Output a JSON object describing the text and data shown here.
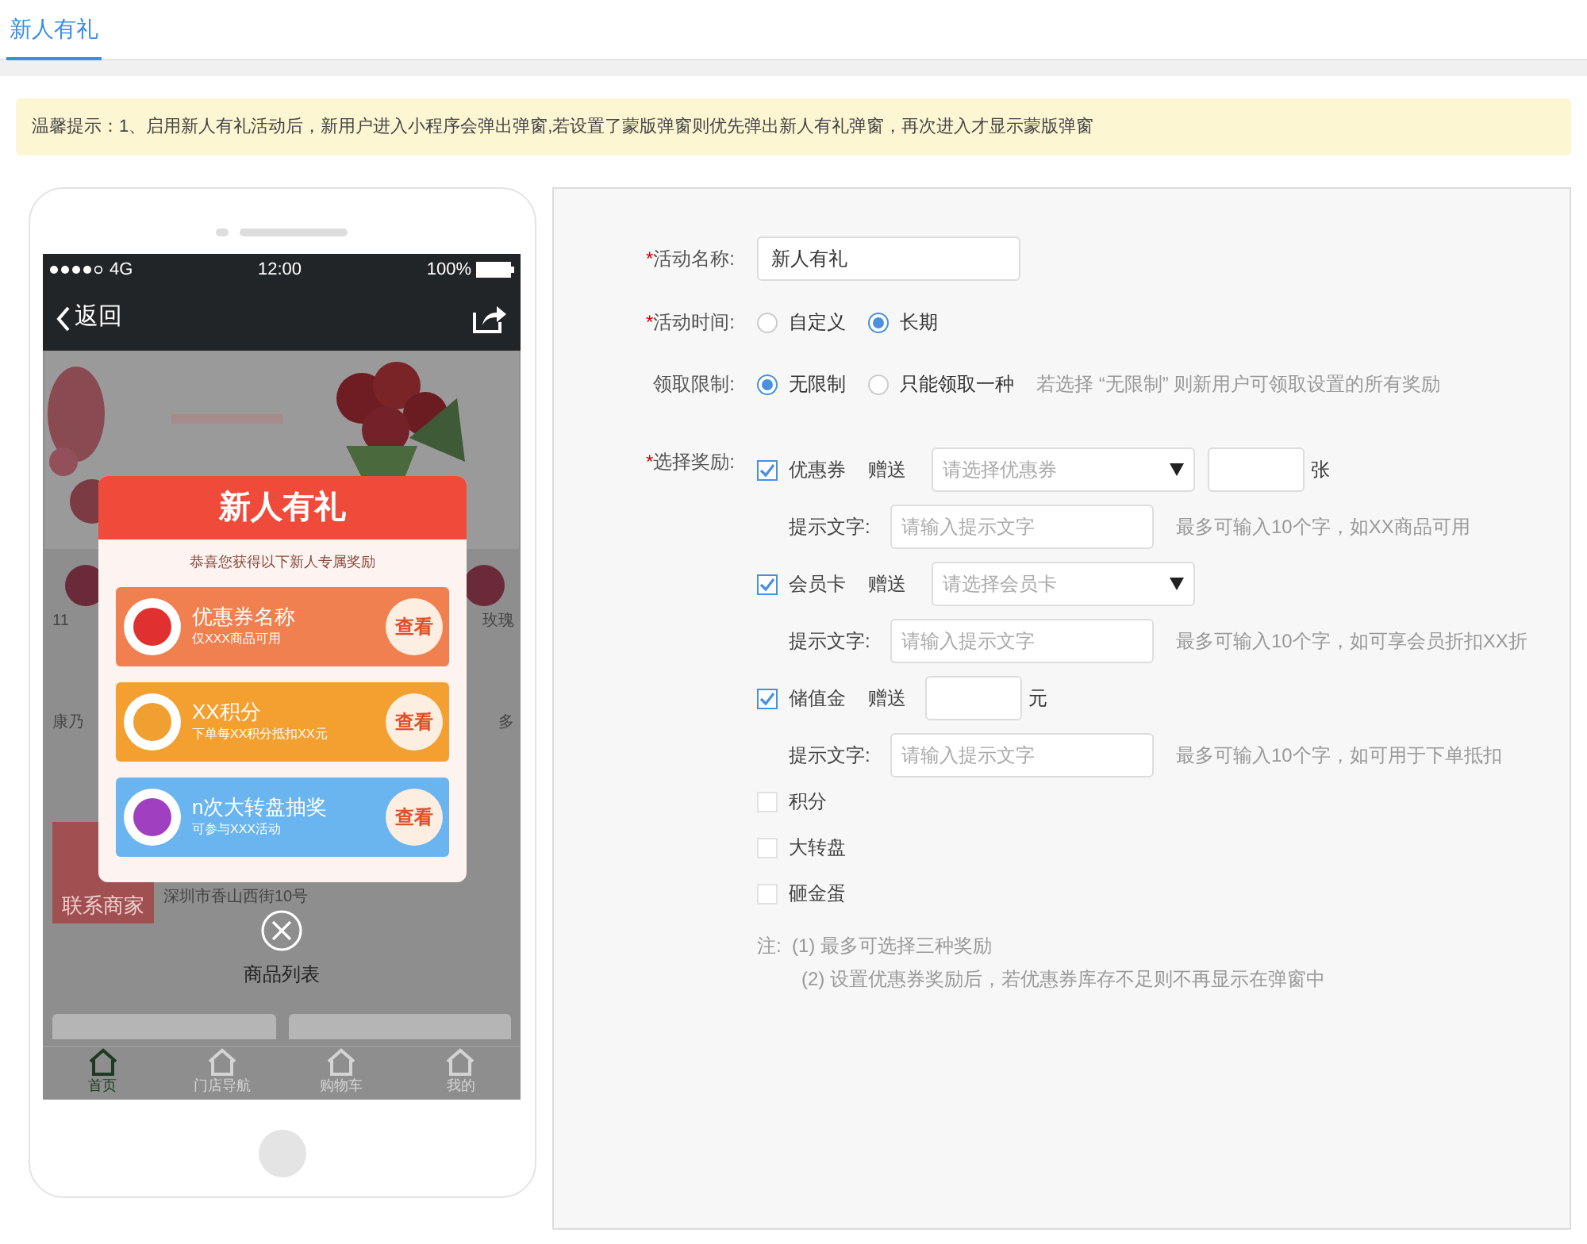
{
  "tabs": [
    {
      "label": "新人有礼",
      "selected": true
    }
  ],
  "notice": "温馨提示：1、启用新人有礼活动后，新用户进入小程序会弹出弹窗,若设置了蒙版弹窗则优先弹出新人有礼弹窗，再次进入才显示蒙版弹窗",
  "phone": {
    "status": {
      "network": "4G",
      "time": "12:00",
      "battery": "100%"
    },
    "nav": {
      "back": "返回"
    },
    "categories": [
      {
        "label": "11"
      },
      {
        "label": "玫瑰"
      },
      {
        "label": "康乃"
      },
      {
        "label": "多"
      }
    ],
    "contact": "联系商家",
    "address": "深圳市香山西街10号",
    "section": "商品列表",
    "tabbar": [
      {
        "label": "首页",
        "selected": true
      },
      {
        "label": "门店导航",
        "selected": false
      },
      {
        "label": "购物车",
        "selected": false
      },
      {
        "label": "我的",
        "selected": false
      }
    ],
    "popup": {
      "title": "新人有礼",
      "subtitle": "恭喜您获得以下新人专属奖励",
      "rewards": [
        {
          "kind": "coupon",
          "title": "优惠券名称",
          "desc": "仅XXX商品可用",
          "button": "查看"
        },
        {
          "kind": "points",
          "title": "XX积分",
          "desc": "下单每XX积分抵扣XX元",
          "button": "查看"
        },
        {
          "kind": "wheel",
          "title": "n次大转盘抽奖",
          "desc": "可参与XXX活动",
          "button": "查看"
        }
      ]
    }
  },
  "form": {
    "required_mark": "*",
    "name": {
      "label": "活动名称:",
      "required": true,
      "value": "新人有礼"
    },
    "time": {
      "label": "活动时间:",
      "required": true,
      "options": [
        {
          "label": "自定义",
          "selected": false
        },
        {
          "label": "长期",
          "selected": true
        }
      ]
    },
    "limit": {
      "label": "领取限制:",
      "required": false,
      "options": [
        {
          "label": "无限制",
          "selected": true
        },
        {
          "label": "只能领取一种",
          "selected": false
        }
      ],
      "hint": "若选择 “无限制” 则新用户可领取设置的所有奖励"
    },
    "rewards": {
      "label": "选择奖励:",
      "required": true,
      "items": [
        {
          "kind": "select",
          "label": "优惠券",
          "checked": true,
          "give": "赠送",
          "placeholder": "请选择优惠券",
          "unit": "张",
          "tip_label": "提示文字:",
          "tip_placeholder": "请输入提示文字",
          "tip_hint": "最多可输入10个字，如XX商品可用"
        },
        {
          "kind": "select",
          "label": "会员卡",
          "checked": true,
          "give": "赠送",
          "placeholder": "请选择会员卡",
          "tip_label": "提示文字:",
          "tip_placeholder": "请输入提示文字",
          "tip_hint": "最多可输入10个字，如可享会员折扣XX折"
        },
        {
          "kind": "amount",
          "label": "储值金",
          "checked": true,
          "give": "赠送",
          "unit": "元",
          "tip_label": "提示文字:",
          "tip_placeholder": "请输入提示文字",
          "tip_hint": "最多可输入10个字，如可用于下单抵扣"
        },
        {
          "kind": "plain",
          "label": "积分",
          "checked": false
        },
        {
          "kind": "plain",
          "label": "大转盘",
          "checked": false
        },
        {
          "kind": "plain",
          "label": "砸金蛋",
          "checked": false
        }
      ]
    },
    "notes": {
      "prefix": "注:",
      "lines": [
        "(1) 最多可选择三种奖励",
        "(2) 设置优惠券奖励后，若优惠券库存不足则不再显示在弹窗中"
      ]
    }
  }
}
